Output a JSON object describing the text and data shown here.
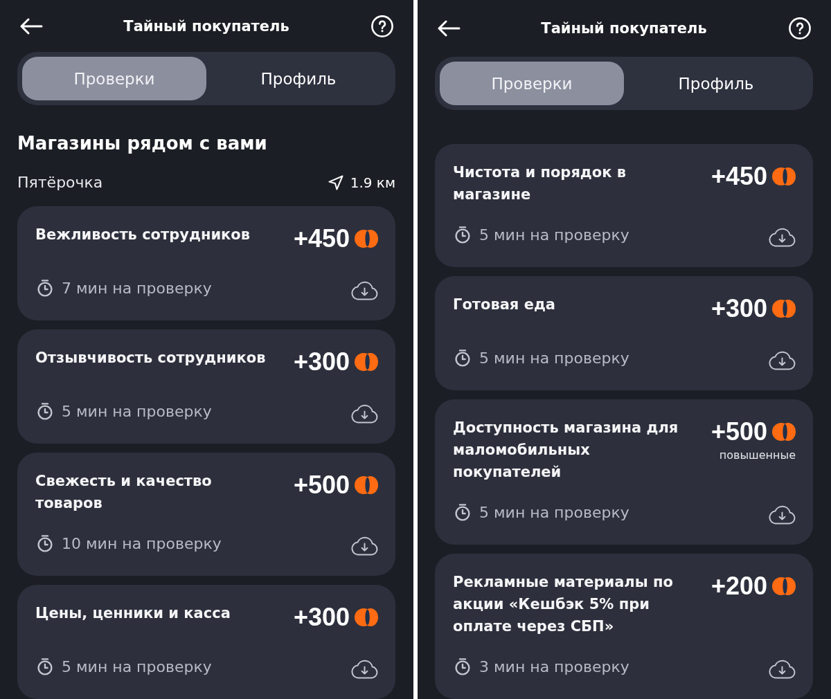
{
  "screens": [
    {
      "header": {
        "title": "Тайный покупатель"
      },
      "tabs": [
        {
          "label": "Проверки",
          "selected": true
        },
        {
          "label": "Профиль",
          "selected": false
        }
      ],
      "section_title": "Магазины рядом с вами",
      "store": {
        "name": "Пятёрочка",
        "distance": "1.9 км"
      },
      "tasks": [
        {
          "title": "Вежливость сотрудников",
          "points": "+450",
          "duration": "7 мин на проверку"
        },
        {
          "title": "Отзывчивость сотрудников",
          "points": "+300",
          "duration": "5 мин на проверку"
        },
        {
          "title": "Свежесть и качество товаров",
          "points": "+500",
          "duration": "10 мин на проверку"
        },
        {
          "title": "Цены, ценники и касса",
          "points": "+300",
          "duration": "5 мин на проверку"
        }
      ]
    },
    {
      "header": {
        "title": "Тайный покупатель"
      },
      "tabs": [
        {
          "label": "Проверки",
          "selected": true
        },
        {
          "label": "Профиль",
          "selected": false
        }
      ],
      "tasks": [
        {
          "title": "Чистота и порядок в магазине",
          "points": "+450",
          "duration": "5 мин на проверку"
        },
        {
          "title": "Готовая еда",
          "points": "+300",
          "duration": "5 мин на проверку"
        },
        {
          "title": "Доступность магазина для маломобильных покупателей",
          "points": "+500",
          "note": "повышенные",
          "duration": "5 мин на проверку"
        },
        {
          "title": "Рекламные материалы по акции «Кешбэк 5% при оплате через СБП»",
          "points": "+200",
          "duration": "3 мин на проверку"
        }
      ]
    }
  ]
}
